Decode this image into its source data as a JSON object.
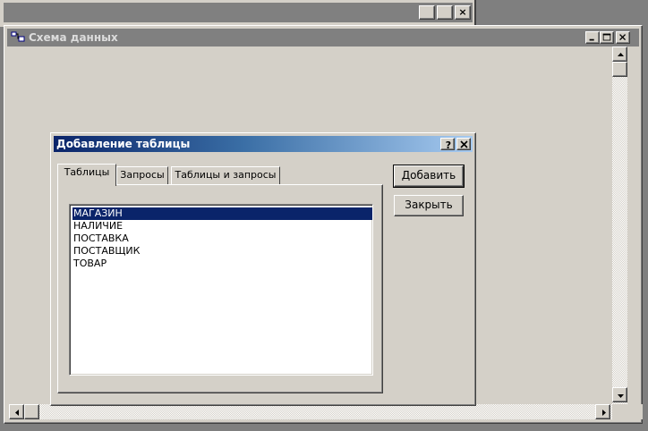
{
  "main_window": {
    "title": "Схема данных",
    "minimize_glyph": "_",
    "maximize_glyph": "□",
    "close_glyph": "×"
  },
  "dialog": {
    "title": "Добавление таблицы",
    "help_glyph": "?",
    "close_glyph": "×",
    "tabs": [
      {
        "label": "Таблицы",
        "active": true
      },
      {
        "label": "Запросы",
        "active": false
      },
      {
        "label": "Таблицы и запросы",
        "active": false
      }
    ],
    "list_items": [
      {
        "label": "МАГАЗИН",
        "selected": true
      },
      {
        "label": "НАЛИЧИЕ",
        "selected": false
      },
      {
        "label": "ПОСТАВКА",
        "selected": false
      },
      {
        "label": "ПОСТАВЩИК",
        "selected": false
      },
      {
        "label": "ТОВАР",
        "selected": false
      }
    ],
    "add_button": "Добавить",
    "close_button": "Закрыть"
  },
  "colors": {
    "face": "#d4d0c8",
    "active_title_start": "#0a246a",
    "active_title_end": "#a6caf0",
    "selection": "#0a246a"
  }
}
